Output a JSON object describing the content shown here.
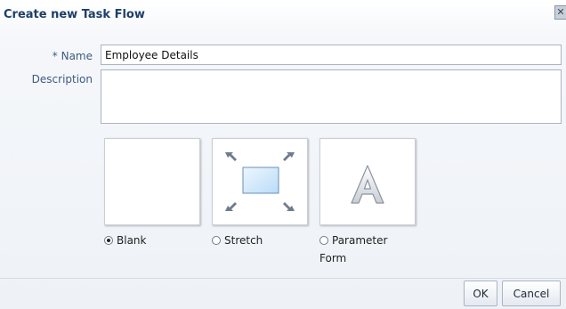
{
  "dialog": {
    "title": "Create new Task Flow",
    "close_glyph": "✕"
  },
  "form": {
    "name_required_marker": "*",
    "name_label": "Name",
    "name_value": "Employee Details",
    "description_label": "Description",
    "description_value": ""
  },
  "layouts": {
    "options": [
      {
        "label": "Blank",
        "selected": true,
        "icon": "blank-layout-icon"
      },
      {
        "label": "Stretch",
        "selected": false,
        "icon": "stretch-layout-icon"
      },
      {
        "label": "Parameter\nForm",
        "label_line1": "Parameter",
        "label_line2": "Form",
        "selected": false,
        "icon": "parameter-form-icon"
      }
    ]
  },
  "buttons": {
    "ok": "OK",
    "cancel": "Cancel"
  },
  "colors": {
    "title": "#1f3e66",
    "label": "#3d5a80",
    "border": "#aab4c2"
  }
}
